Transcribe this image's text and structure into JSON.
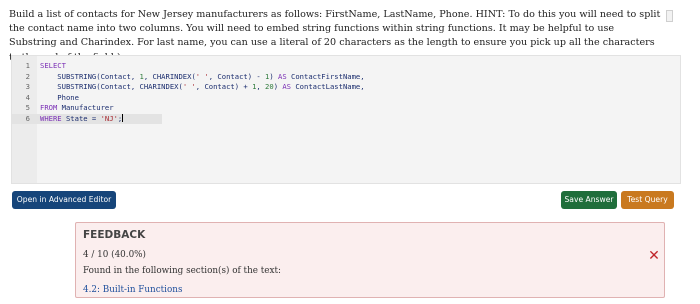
{
  "question": {
    "text": "Build a list of contacts for New Jersey manufacturers as follows: FirstName, LastName, Phone. HINT: To do this you will need to split the contact name into two columns. You will need to embed string functions within string functions. It may be helpful to use Substring and Charindex. For last name, you can use a literal of 20 characters as the length to ensure you pick up all the characters to the end of the field.)"
  },
  "editor": {
    "lines": [
      {
        "no": "1",
        "tokens": [
          {
            "t": "SELECT",
            "c": "kw"
          }
        ]
      },
      {
        "no": "2",
        "tokens": [
          {
            "t": "    SUBSTRING(Contact, ",
            "c": "ident"
          },
          {
            "t": "1",
            "c": "num"
          },
          {
            "t": ", CHARINDEX(",
            "c": "ident"
          },
          {
            "t": "' '",
            "c": "str"
          },
          {
            "t": ", Contact) - ",
            "c": "ident"
          },
          {
            "t": "1",
            "c": "num"
          },
          {
            "t": ") ",
            "c": "ident"
          },
          {
            "t": "AS",
            "c": "kw"
          },
          {
            "t": " ContactFirstName,",
            "c": "ident"
          }
        ]
      },
      {
        "no": "3",
        "tokens": [
          {
            "t": "    SUBSTRING(Contact, CHARINDEX(",
            "c": "ident"
          },
          {
            "t": "' '",
            "c": "str"
          },
          {
            "t": ", Contact) + ",
            "c": "ident"
          },
          {
            "t": "1",
            "c": "num"
          },
          {
            "t": ", ",
            "c": "ident"
          },
          {
            "t": "20",
            "c": "num"
          },
          {
            "t": ") ",
            "c": "ident"
          },
          {
            "t": "AS",
            "c": "kw"
          },
          {
            "t": " ContactLastName,",
            "c": "ident"
          }
        ]
      },
      {
        "no": "4",
        "tokens": [
          {
            "t": "    Phone",
            "c": "ident"
          }
        ]
      },
      {
        "no": "5",
        "tokens": [
          {
            "t": "FROM",
            "c": "kw"
          },
          {
            "t": " Manufacturer",
            "c": "ident"
          }
        ]
      },
      {
        "no": "6",
        "tokens": [
          {
            "t": "WHERE",
            "c": "kw"
          },
          {
            "t": " State = ",
            "c": "ident"
          },
          {
            "t": "'NJ'",
            "c": "str"
          },
          {
            "t": ";",
            "c": "ident"
          }
        ],
        "active": true
      }
    ]
  },
  "buttons": {
    "open_editor": "Open in Advanced Editor",
    "save": "Save Answer",
    "test": "Test Query"
  },
  "feedback": {
    "title": "FEEDBACK",
    "score": "4 / 10 (40.0%)",
    "found_text": "Found in the following section(s) of the text:",
    "section_link": "4.2: Built-in Functions",
    "status_icon": "close-x-icon",
    "status_color": "#c0262b"
  }
}
